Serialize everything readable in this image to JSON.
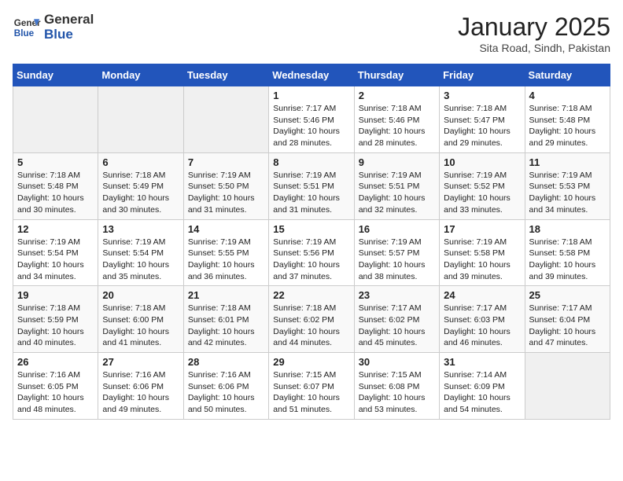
{
  "header": {
    "logo_line1": "General",
    "logo_line2": "Blue",
    "title": "January 2025",
    "subtitle": "Sita Road, Sindh, Pakistan"
  },
  "days_of_week": [
    "Sunday",
    "Monday",
    "Tuesday",
    "Wednesday",
    "Thursday",
    "Friday",
    "Saturday"
  ],
  "weeks": [
    [
      {
        "day": "",
        "info": ""
      },
      {
        "day": "",
        "info": ""
      },
      {
        "day": "",
        "info": ""
      },
      {
        "day": "1",
        "info": "Sunrise: 7:17 AM\nSunset: 5:46 PM\nDaylight: 10 hours\nand 28 minutes."
      },
      {
        "day": "2",
        "info": "Sunrise: 7:18 AM\nSunset: 5:46 PM\nDaylight: 10 hours\nand 28 minutes."
      },
      {
        "day": "3",
        "info": "Sunrise: 7:18 AM\nSunset: 5:47 PM\nDaylight: 10 hours\nand 29 minutes."
      },
      {
        "day": "4",
        "info": "Sunrise: 7:18 AM\nSunset: 5:48 PM\nDaylight: 10 hours\nand 29 minutes."
      }
    ],
    [
      {
        "day": "5",
        "info": "Sunrise: 7:18 AM\nSunset: 5:48 PM\nDaylight: 10 hours\nand 30 minutes."
      },
      {
        "day": "6",
        "info": "Sunrise: 7:18 AM\nSunset: 5:49 PM\nDaylight: 10 hours\nand 30 minutes."
      },
      {
        "day": "7",
        "info": "Sunrise: 7:19 AM\nSunset: 5:50 PM\nDaylight: 10 hours\nand 31 minutes."
      },
      {
        "day": "8",
        "info": "Sunrise: 7:19 AM\nSunset: 5:51 PM\nDaylight: 10 hours\nand 31 minutes."
      },
      {
        "day": "9",
        "info": "Sunrise: 7:19 AM\nSunset: 5:51 PM\nDaylight: 10 hours\nand 32 minutes."
      },
      {
        "day": "10",
        "info": "Sunrise: 7:19 AM\nSunset: 5:52 PM\nDaylight: 10 hours\nand 33 minutes."
      },
      {
        "day": "11",
        "info": "Sunrise: 7:19 AM\nSunset: 5:53 PM\nDaylight: 10 hours\nand 34 minutes."
      }
    ],
    [
      {
        "day": "12",
        "info": "Sunrise: 7:19 AM\nSunset: 5:54 PM\nDaylight: 10 hours\nand 34 minutes."
      },
      {
        "day": "13",
        "info": "Sunrise: 7:19 AM\nSunset: 5:54 PM\nDaylight: 10 hours\nand 35 minutes."
      },
      {
        "day": "14",
        "info": "Sunrise: 7:19 AM\nSunset: 5:55 PM\nDaylight: 10 hours\nand 36 minutes."
      },
      {
        "day": "15",
        "info": "Sunrise: 7:19 AM\nSunset: 5:56 PM\nDaylight: 10 hours\nand 37 minutes."
      },
      {
        "day": "16",
        "info": "Sunrise: 7:19 AM\nSunset: 5:57 PM\nDaylight: 10 hours\nand 38 minutes."
      },
      {
        "day": "17",
        "info": "Sunrise: 7:19 AM\nSunset: 5:58 PM\nDaylight: 10 hours\nand 39 minutes."
      },
      {
        "day": "18",
        "info": "Sunrise: 7:18 AM\nSunset: 5:58 PM\nDaylight: 10 hours\nand 39 minutes."
      }
    ],
    [
      {
        "day": "19",
        "info": "Sunrise: 7:18 AM\nSunset: 5:59 PM\nDaylight: 10 hours\nand 40 minutes."
      },
      {
        "day": "20",
        "info": "Sunrise: 7:18 AM\nSunset: 6:00 PM\nDaylight: 10 hours\nand 41 minutes."
      },
      {
        "day": "21",
        "info": "Sunrise: 7:18 AM\nSunset: 6:01 PM\nDaylight: 10 hours\nand 42 minutes."
      },
      {
        "day": "22",
        "info": "Sunrise: 7:18 AM\nSunset: 6:02 PM\nDaylight: 10 hours\nand 44 minutes."
      },
      {
        "day": "23",
        "info": "Sunrise: 7:17 AM\nSunset: 6:02 PM\nDaylight: 10 hours\nand 45 minutes."
      },
      {
        "day": "24",
        "info": "Sunrise: 7:17 AM\nSunset: 6:03 PM\nDaylight: 10 hours\nand 46 minutes."
      },
      {
        "day": "25",
        "info": "Sunrise: 7:17 AM\nSunset: 6:04 PM\nDaylight: 10 hours\nand 47 minutes."
      }
    ],
    [
      {
        "day": "26",
        "info": "Sunrise: 7:16 AM\nSunset: 6:05 PM\nDaylight: 10 hours\nand 48 minutes."
      },
      {
        "day": "27",
        "info": "Sunrise: 7:16 AM\nSunset: 6:06 PM\nDaylight: 10 hours\nand 49 minutes."
      },
      {
        "day": "28",
        "info": "Sunrise: 7:16 AM\nSunset: 6:06 PM\nDaylight: 10 hours\nand 50 minutes."
      },
      {
        "day": "29",
        "info": "Sunrise: 7:15 AM\nSunset: 6:07 PM\nDaylight: 10 hours\nand 51 minutes."
      },
      {
        "day": "30",
        "info": "Sunrise: 7:15 AM\nSunset: 6:08 PM\nDaylight: 10 hours\nand 53 minutes."
      },
      {
        "day": "31",
        "info": "Sunrise: 7:14 AM\nSunset: 6:09 PM\nDaylight: 10 hours\nand 54 minutes."
      },
      {
        "day": "",
        "info": ""
      }
    ]
  ]
}
